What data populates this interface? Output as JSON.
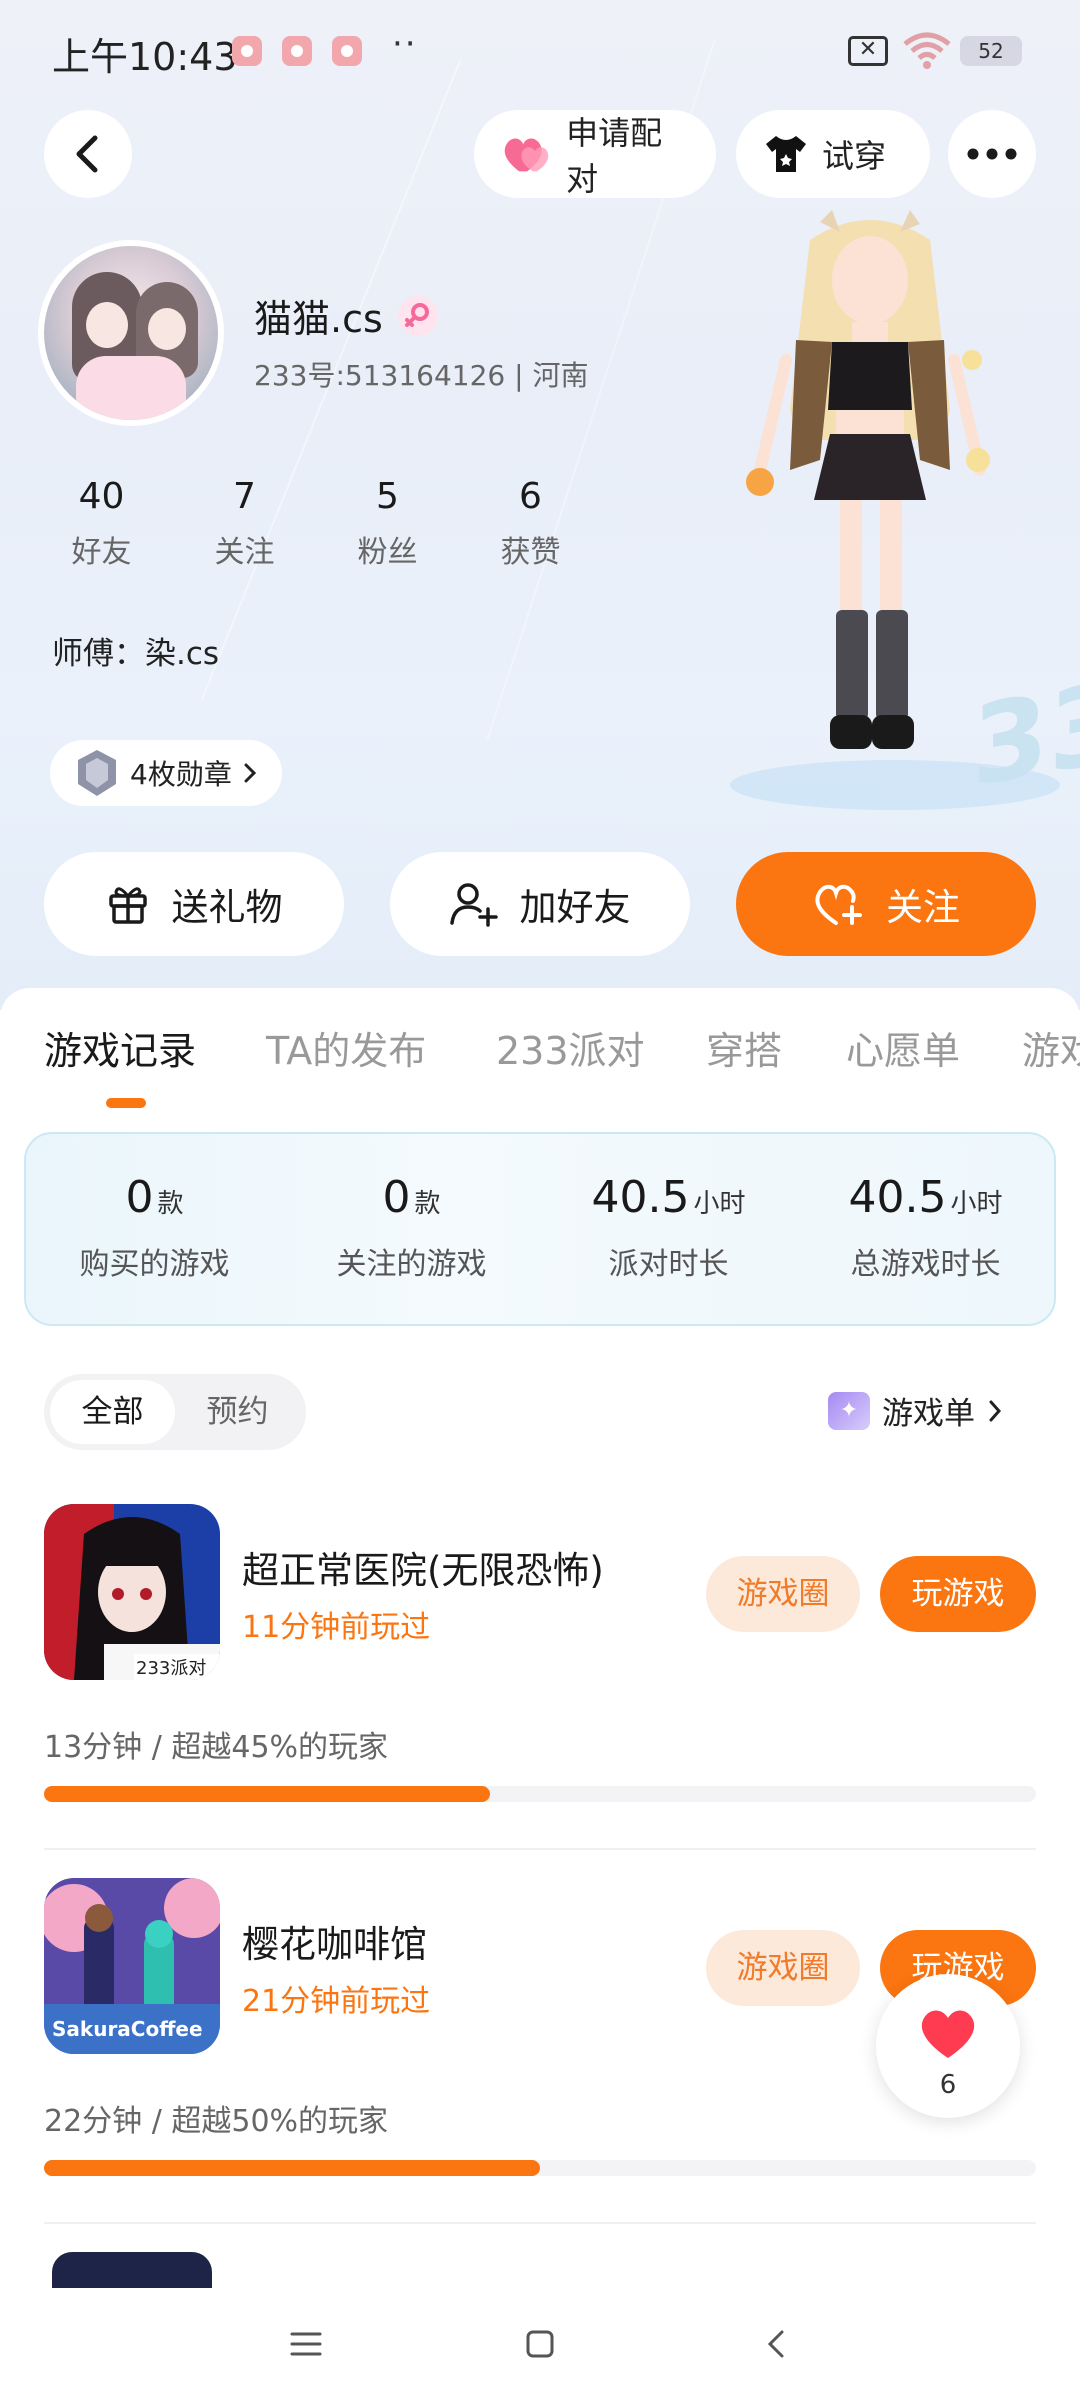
{
  "status_bar": {
    "time": "上午10:43",
    "battery": "52"
  },
  "top_nav": {
    "match_label": "申请配对",
    "tryon_label": "试穿"
  },
  "profile": {
    "name": "猫猫.cs",
    "uid_line": "233号:513164126 | 河南",
    "stats": [
      {
        "value": "40",
        "label": "好友"
      },
      {
        "value": "7",
        "label": "关注"
      },
      {
        "value": "5",
        "label": "粉丝"
      },
      {
        "value": "6",
        "label": "获赞"
      }
    ],
    "master": "师傅：染.cs",
    "medals": "4枚勋章"
  },
  "actions": {
    "gift": "送礼物",
    "add_friend": "加好友",
    "follow": "关注"
  },
  "tabs": [
    "游戏记录",
    "TA的发布",
    "233派对",
    "穿搭",
    "心愿单",
    "游戏"
  ],
  "summary": [
    {
      "value": "0",
      "unit": "款",
      "label": "购买的游戏"
    },
    {
      "value": "0",
      "unit": "款",
      "label": "关注的游戏"
    },
    {
      "value": "40.5",
      "unit": "小时",
      "label": "派对时长"
    },
    {
      "value": "40.5",
      "unit": "小时",
      "label": "总游戏时长"
    }
  ],
  "filter": {
    "all": "全部",
    "reserve": "预约",
    "gamelist": "游戏单"
  },
  "games": [
    {
      "title": "超正常医院(无限恐怖)",
      "played": "11分钟前玩过",
      "circle": "游戏圈",
      "play": "玩游戏",
      "stat": "13分钟 / 超越45%的玩家",
      "percentile": 0.45,
      "icon_text": "233派对"
    },
    {
      "title": "樱花咖啡馆",
      "played": "21分钟前玩过",
      "circle": "游戏圈",
      "play": "玩游戏",
      "stat": "22分钟 / 超越50%的玩家",
      "percentile": 0.5,
      "icon_text": "SakuraCoffee"
    }
  ],
  "like_fab": {
    "count": "6"
  },
  "colors": {
    "accent": "#fb7510",
    "accent_soft": "#fde9da"
  }
}
